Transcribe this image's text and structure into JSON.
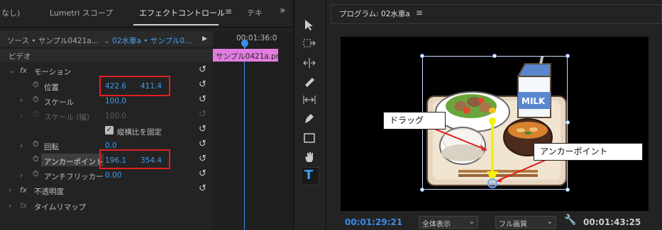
{
  "tabs": {
    "partial": "なし)",
    "lumetri": "Lumetri スコープ",
    "effect_controls": "エフェクトコントロール",
    "text": "テキ",
    "overflow": "»"
  },
  "source": {
    "source_label": "ソース • サンプル0421a...",
    "clip_label": "02水車a • サンプル0...",
    "timecode": "00:01:36:0",
    "clip_name": "サンプル0421a.pr"
  },
  "effects": {
    "video_header": "ビデオ",
    "motion": "モーション",
    "position_label": "位置",
    "position_x": "422.6",
    "position_y": "411.4",
    "scale_label": "スケール",
    "scale_value": "100.0",
    "scale_width_label": "スケール (幅)",
    "scale_width_value": "100.0",
    "uniform_scale": "縦横比を固定",
    "rotation_label": "回転",
    "rotation_value": "0.0",
    "anchor_label": "アンカーポイント",
    "anchor_x": "196.1",
    "anchor_y": "354.4",
    "antiflicker_label": "アンチフリッカー",
    "antiflicker_value": "0.00",
    "opacity": "不透明度",
    "time_remap": "タイムリマップ"
  },
  "program": {
    "title": "プログラム: 02水車a",
    "timecode_current": "00:01:29:21",
    "fit_select": "全体表示",
    "quality_select": "フル画質",
    "timecode_duration": "00:01:43:25"
  },
  "callouts": {
    "drag": "ドラッグ",
    "anchor": "アンカーポイント"
  },
  "illustration": {
    "milk_text": "MILK"
  },
  "colors": {
    "value_blue": "#3a9ef5",
    "highlight_red": "#e02020",
    "clip_pink": "#e27ce0",
    "arrow_yellow": "#f5f200",
    "timecode_blue": "#3c8cf0"
  }
}
